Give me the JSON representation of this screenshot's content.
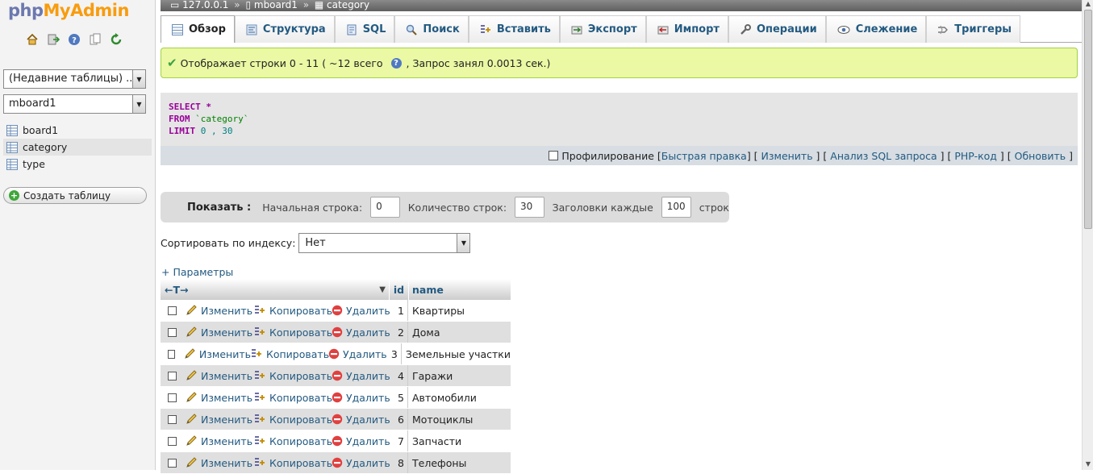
{
  "logo": {
    "php": "php",
    "my": "My",
    "admin": "Admin"
  },
  "nav_icons": [
    "home-icon",
    "exit-icon",
    "help-icon",
    "docs-icon",
    "reload-icon"
  ],
  "recent_tables": {
    "value": "(Недавние таблицы) ..."
  },
  "database_select": {
    "value": "mboard1"
  },
  "sidebar": {
    "tables": [
      {
        "label": "board1"
      },
      {
        "label": "category"
      },
      {
        "label": "type"
      }
    ],
    "create_table": "Создать таблицу"
  },
  "breadcrumb": {
    "server": "127.0.0.1",
    "database": "mboard1",
    "table": "category"
  },
  "tabs": [
    {
      "label": "Обзор",
      "icon": "browse-icon"
    },
    {
      "label": "Структура",
      "icon": "structure-icon"
    },
    {
      "label": "SQL",
      "icon": "sql-icon"
    },
    {
      "label": "Поиск",
      "icon": "search-icon"
    },
    {
      "label": "Вставить",
      "icon": "insert-icon"
    },
    {
      "label": "Экспорт",
      "icon": "export-icon"
    },
    {
      "label": "Импорт",
      "icon": "import-icon"
    },
    {
      "label": "Операции",
      "icon": "operations-icon"
    },
    {
      "label": "Слежение",
      "icon": "tracking-icon"
    },
    {
      "label": "Триггеры",
      "icon": "triggers-icon"
    }
  ],
  "message": {
    "text": "Отображает строки 0 - 11 ( ~12 всего",
    "tail": ", Запрос занял 0.0013 сек.)"
  },
  "sql": {
    "select_kw": "SELECT",
    "select_rest": " *",
    "from_kw": "FROM",
    "from_rest": " `category`",
    "limit_kw": "LIMIT",
    "limit_rest": " 0 , 30"
  },
  "sql_tools": {
    "profiling": "Профилирование",
    "links": [
      "Быстрая правка",
      "Изменить",
      "Анализ SQL запроса",
      "PHP-код",
      "Обновить"
    ]
  },
  "navbar": {
    "show": "Показать :",
    "start_label": "Начальная строка:",
    "start_value": "0",
    "count_label": "Количество строк:",
    "count_value": "30",
    "headers_label": "Заголовки каждые",
    "headers_value": "100",
    "rows_suffix": "строк"
  },
  "sort": {
    "label": "Сортировать по индексу:",
    "value": "Нет"
  },
  "params_link": "+ Параметры",
  "table": {
    "arrows": "←T→",
    "columns": [
      "id",
      "name"
    ],
    "actions": {
      "edit": "Изменить",
      "copy": "Копировать",
      "delete": "Удалить"
    },
    "rows": [
      {
        "id": "1",
        "name": "Квартиры"
      },
      {
        "id": "2",
        "name": "Дома"
      },
      {
        "id": "3",
        "name": "Земельные участки"
      },
      {
        "id": "4",
        "name": "Гаражи"
      },
      {
        "id": "5",
        "name": "Автомобили"
      },
      {
        "id": "6",
        "name": "Мотоциклы"
      },
      {
        "id": "7",
        "name": "Запчасти"
      },
      {
        "id": "8",
        "name": "Телефоны"
      }
    ]
  },
  "colors": {
    "link": "#235a81",
    "success_bg": "#ebf8a4",
    "sql_keyword": "#990099"
  }
}
